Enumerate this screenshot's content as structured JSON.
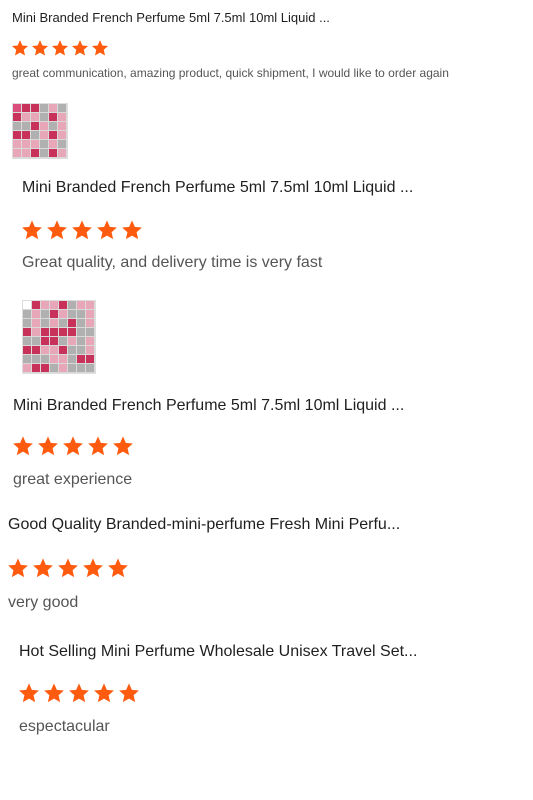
{
  "accent_color": "#ff5b0f",
  "reviews": [
    {
      "product": "Mini Branded French Perfume 5ml 7.5ml 10ml Liquid ...",
      "rating": 5,
      "comment": "great communication, amazing product, quick shipment, I would like to order again",
      "photo": "perfume-photo"
    },
    {
      "product": "Mini Branded French Perfume 5ml 7.5ml 10ml Liquid ...",
      "rating": 5,
      "comment": "Great quality, and delivery time is very fast",
      "photo": "perfume-photo"
    },
    {
      "product": "Mini Branded French Perfume 5ml 7.5ml 10ml Liquid ...",
      "rating": 5,
      "comment": "great experience"
    },
    {
      "product": "Good Quality Branded-mini-perfume Fresh Mini Perfu...",
      "rating": 5,
      "comment": "very good"
    },
    {
      "product": "Hot Selling Mini Perfume Wholesale Unisex Travel Set...",
      "rating": 5,
      "comment": "espectacular"
    }
  ]
}
